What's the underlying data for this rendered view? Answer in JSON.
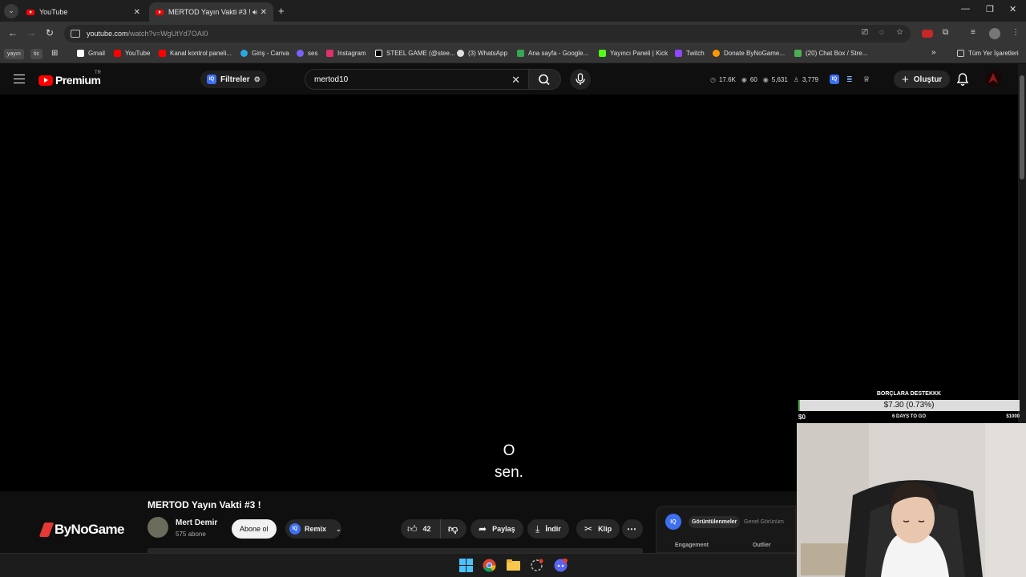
{
  "browser": {
    "tabs": [
      {
        "title": "YouTube"
      },
      {
        "title": "MERTOD Yayın Vakti #3 ! - YouTube"
      }
    ],
    "url_host": "youtube.com",
    "url_path": "/watch?v=WgUtYd7OAI0",
    "bookmarks": [
      {
        "label": "Gmail",
        "color": "#ffffff"
      },
      {
        "label": "YouTube",
        "color": "#ff0000"
      },
      {
        "label": "Kanal kontrol paneli...",
        "color": "#ff0000"
      },
      {
        "label": "Giriş - Canva",
        "color": "#2aa8e0"
      },
      {
        "label": "ses",
        "color": "#7b61ff"
      },
      {
        "label": "Instagram",
        "color": "#e1306c"
      },
      {
        "label": "STEEL GAME (@stee...",
        "color": "#ffffff"
      },
      {
        "label": "(3) WhatsApp",
        "color": "#e0e0e0"
      },
      {
        "label": "Ana sayfa - Google...",
        "color": "#34a853"
      },
      {
        "label": "Yayıncı Paneli | Kick",
        "color": "#53fc18"
      },
      {
        "label": "Twitch",
        "color": "#9146ff"
      },
      {
        "label": "Donate ByNoGame...",
        "color": "#ff9800"
      },
      {
        "label": "(20) Chat Box / Stre...",
        "color": "#4caf50"
      }
    ],
    "bookmark_pills": [
      "yayın",
      "tic"
    ],
    "all_bookmarks": "Tüm Yer İşaretleri"
  },
  "masthead": {
    "logo_text": "Premium",
    "region": "TR",
    "filters_label": "Filtreler",
    "search_value": "mertod10",
    "stats": {
      "views": "17.6K",
      "watching": "60",
      "total": "5,631",
      "subs": "3,779"
    },
    "create_label": "Oluştur"
  },
  "video": {
    "subtitle_line1": "O",
    "subtitle_line2": "sen.",
    "title": "MERTOD Yayın Vakti #3 !",
    "channel_name": "Mert Demir",
    "channel_subs": "575 abone",
    "subscribe_label": "Abone ol",
    "remix_label": "Remix",
    "like_count": "42",
    "share_label": "Paylaş",
    "download_label": "İndir",
    "clip_label": "Klip",
    "sponsor": "ByNoGame"
  },
  "analytics": {
    "iq": "IQ",
    "tab_active": "Görüntülenmeler",
    "tab_other": "Genel Görünüm",
    "col1": "Engagement",
    "col2": "Outlier"
  },
  "donation": {
    "title": "BORÇLARA DESTEKKK",
    "amount": "$7.30 (0.73%)",
    "progress": 0.0073,
    "min": "$0",
    "days": "6 DAYS TO GO",
    "max": "$1000"
  },
  "colors": {
    "accent_red": "#ff0000",
    "iq_blue": "#3d6ff2"
  }
}
